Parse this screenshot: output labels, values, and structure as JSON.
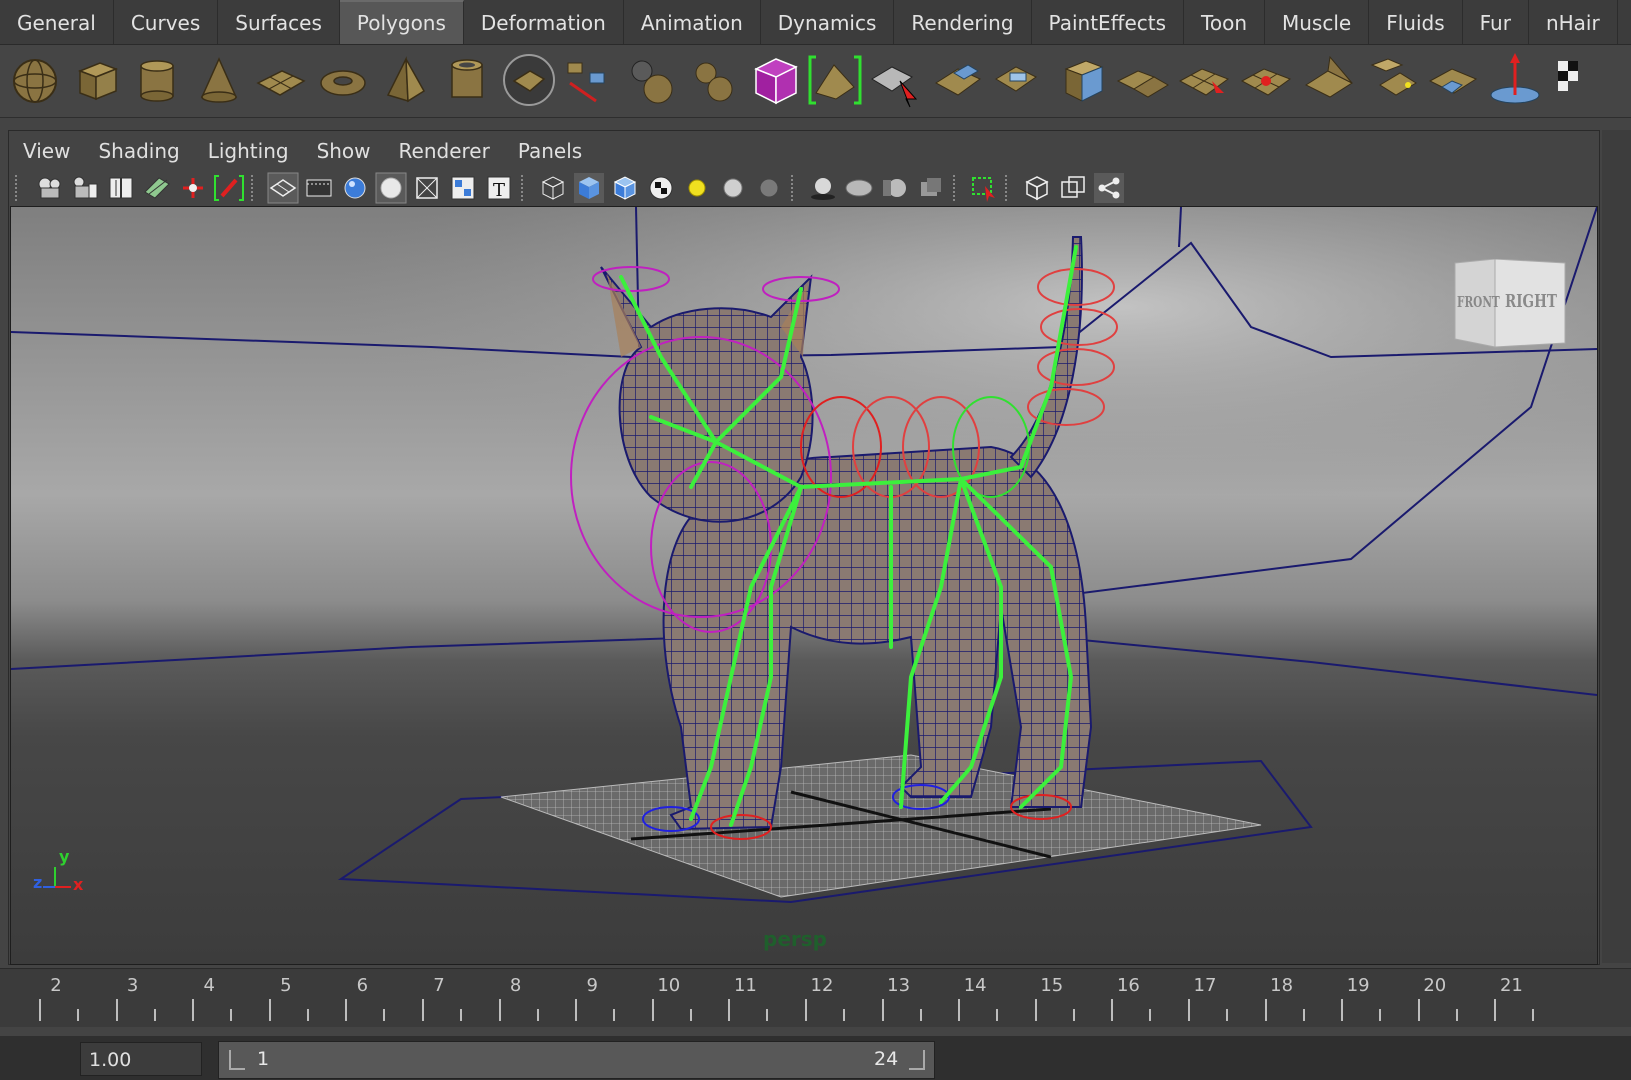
{
  "shelf": {
    "tabs": [
      {
        "label": "General"
      },
      {
        "label": "Curves"
      },
      {
        "label": "Surfaces"
      },
      {
        "label": "Polygons",
        "active": true
      },
      {
        "label": "Deformation"
      },
      {
        "label": "Animation"
      },
      {
        "label": "Dynamics"
      },
      {
        "label": "Rendering"
      },
      {
        "label": "PaintEffects"
      },
      {
        "label": "Toon"
      },
      {
        "label": "Muscle"
      },
      {
        "label": "Fluids"
      },
      {
        "label": "Fur"
      },
      {
        "label": "nHair"
      },
      {
        "label": "n"
      }
    ],
    "icons": [
      "poly-sphere-icon",
      "poly-cube-icon",
      "poly-cylinder-icon",
      "poly-cone-icon",
      "poly-plane-icon",
      "poly-torus-icon",
      "poly-pyramid-icon",
      "poly-pipe-icon",
      "poly-soccer-ball-icon",
      "split-polygon-icon",
      "combine-icon",
      "separate-icon",
      "mirror-cut-icon",
      "bridge-icon",
      "extract-icon",
      "select-faces-icon",
      "extrude-icon",
      "merge-icon",
      "bevel-icon",
      "smooth-icon",
      "wedge-icon",
      "append-icon",
      "split-edge-icon",
      "cut-faces-icon",
      "poke-icon",
      "planar-mapping-icon",
      "move-component-icon",
      "checker-icon"
    ]
  },
  "panel": {
    "menus": [
      "View",
      "Shading",
      "Lighting",
      "Show",
      "Renderer",
      "Panels"
    ],
    "camera": "persp",
    "view_cube": {
      "front": "FRONT",
      "right": "RIGHT"
    },
    "axis": {
      "y": "y",
      "z": "z",
      "x": "x"
    }
  },
  "colors": {
    "accent_active_tab": "#575757",
    "joint_green": "#3cf03c",
    "wireframe_blue": "#1a1a6e",
    "control_magenta": "#c020c0",
    "control_red": "#e02020"
  },
  "timeline": {
    "ticks": [
      "2",
      "3",
      "4",
      "5",
      "6",
      "7",
      "8",
      "9",
      "10",
      "11",
      "12",
      "13",
      "14",
      "15",
      "16",
      "17",
      "18",
      "19",
      "20",
      "21"
    ]
  },
  "range": {
    "start_time": "1.00",
    "range_start": "1",
    "range_end": "24"
  }
}
